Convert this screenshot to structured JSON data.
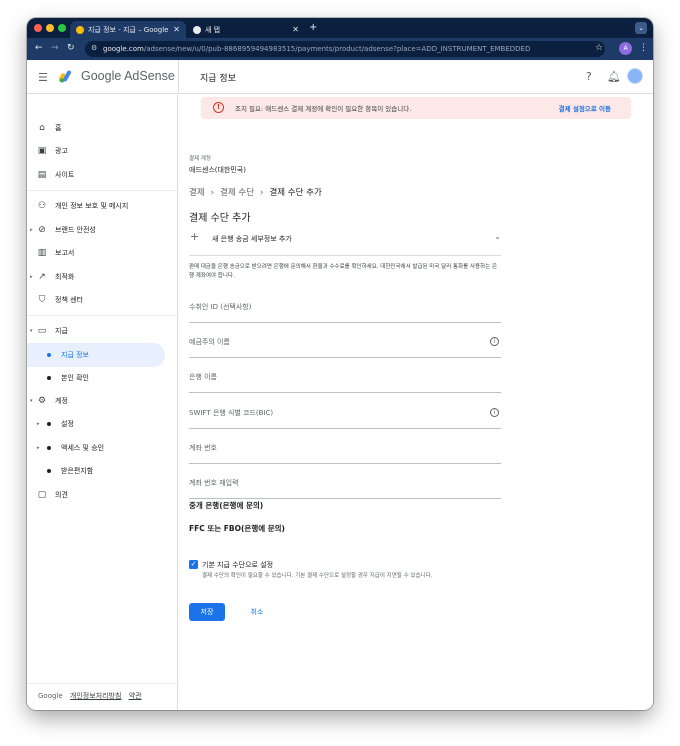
{
  "browser": {
    "tabs": [
      {
        "title": "지급 정보 - 지급 – Google AdSe",
        "active": true
      },
      {
        "title": "새 탭",
        "active": false
      }
    ],
    "new_tab": "+",
    "url_host": "google.com",
    "url_path": "/adsense/new/u/0/pub-8868959494983515/payments/product/adsense?place=ADD_INSTRUMENT_EMBEDDED",
    "profile_initial": "A"
  },
  "header": {
    "brand": "Google AdSense",
    "page_title": "지급 정보"
  },
  "sidebar": {
    "items": [
      {
        "label": "홈",
        "icon": "home-icon"
      },
      {
        "label": "광고",
        "icon": "ads-icon"
      },
      {
        "label": "사이트",
        "icon": "sites-icon"
      },
      {
        "label": "개인 정보 보호 및 메시지",
        "icon": "privacy-icon"
      },
      {
        "label": "브랜드 안전성",
        "icon": "block-icon"
      },
      {
        "label": "보고서",
        "icon": "reports-icon"
      },
      {
        "label": "최적화",
        "icon": "trending-icon"
      },
      {
        "label": "정책 센터",
        "icon": "shield-icon"
      },
      {
        "label": "지급",
        "icon": "payments-icon"
      },
      {
        "label": "지급 정보",
        "icon": "dot"
      },
      {
        "label": "본인 확인",
        "icon": "dot"
      },
      {
        "label": "계정",
        "icon": "gear-icon"
      },
      {
        "label": "설정",
        "icon": "dot"
      },
      {
        "label": "액세스 및 승인",
        "icon": "dot"
      },
      {
        "label": "받은편지함",
        "icon": "dot"
      },
      {
        "label": "의견",
        "icon": "feedback-icon"
      }
    ],
    "footer": {
      "brand": "Google",
      "privacy": "개인정보처리방침",
      "terms": "약관"
    }
  },
  "alert": {
    "text": "조치 필요: 애드센스 결제 계정에 확인이 필요한 항목이 있습니다.",
    "link": "결제 설정으로 이동"
  },
  "account": {
    "label": "결제 계정",
    "value": "애드센스(대한민국)"
  },
  "breadcrumb": [
    "결제",
    "결제 수단",
    "결제 수단 추가"
  ],
  "form": {
    "heading": "결제 수단 추가",
    "expander_label": "새 은행 송금 세부정보 추가",
    "notice": "판매 대금을 은행 송금으로 받으려면 은행에 문의해서 환율과 수수료를 확인하세요. 대한민국에서 발급된 미국 달러 통화를 사용하는 은행 계좌여야 합니다.",
    "fields": [
      {
        "placeholder": "수취인 ID (선택사항)",
        "info": false
      },
      {
        "placeholder": "예금주의 이름",
        "info": true
      },
      {
        "placeholder": "은행 이름",
        "info": false
      },
      {
        "placeholder": "SWIFT 은행 식별 코드(BIC)",
        "info": true
      },
      {
        "placeholder": "계좌 번호",
        "info": false
      },
      {
        "placeholder": "계좌 번호 재입력",
        "info": false
      }
    ],
    "intermediary_bank": "중개 은행(은행에 문의)",
    "ffc_fbo": "FFC 또는 FBO(은행에 문의)",
    "default_checkbox": {
      "label": "기본 지급 수단으로 설정",
      "sublabel": "결제 수단의 확인이 필요할 수 있습니다. 기본 결제 수단으로 설정할 경우 지급이 지연될 수 있습니다.",
      "checked": true
    },
    "save": "저장",
    "cancel": "취소"
  },
  "colors": {
    "accent": "#1a73e8",
    "alert_bg": "#fce8e6",
    "alert_icon": "#d93025",
    "tabstrip": "#0b1f3f",
    "toolbar": "#1e3a66"
  }
}
